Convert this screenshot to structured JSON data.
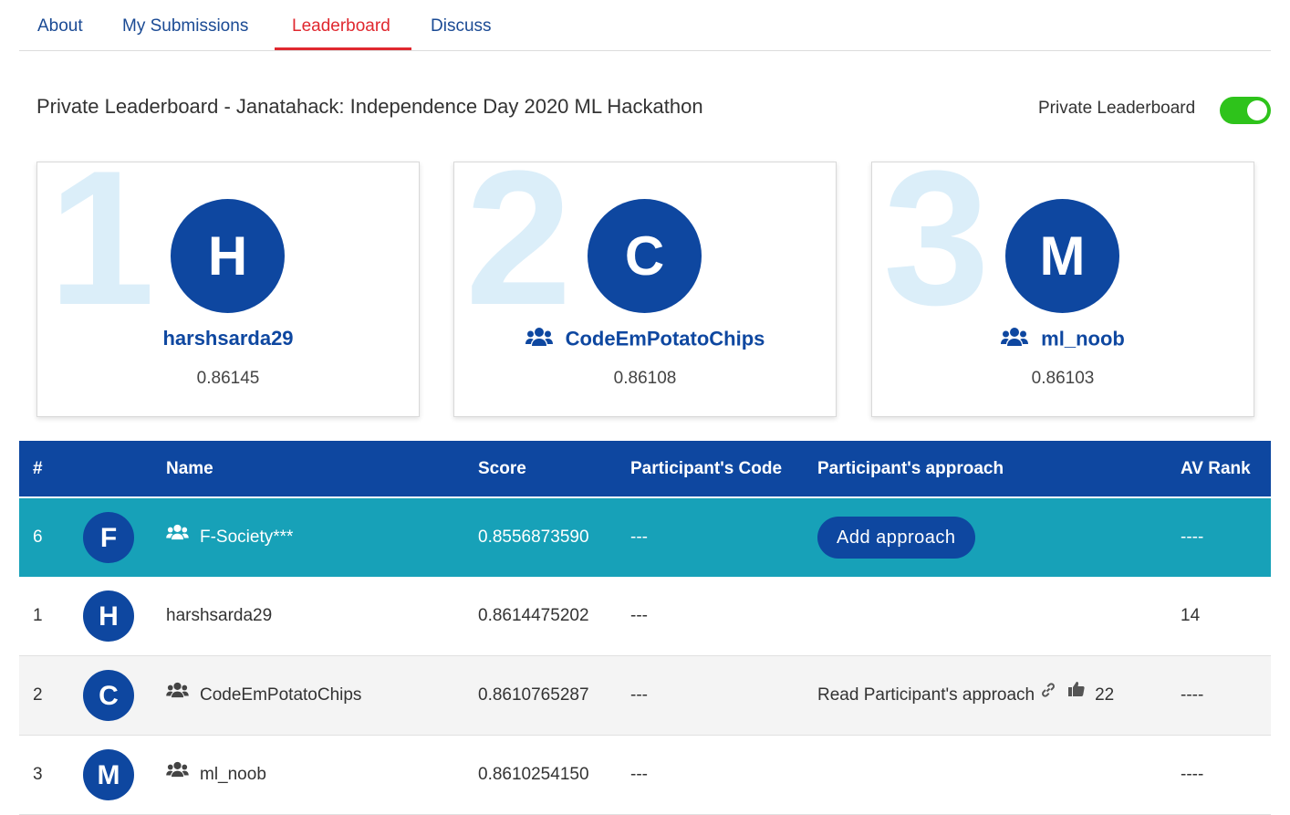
{
  "tabs": [
    {
      "label": "About"
    },
    {
      "label": "My Submissions"
    },
    {
      "label": "Leaderboard"
    },
    {
      "label": "Discuss"
    }
  ],
  "title": "Private Leaderboard - Janatahack: Independence Day 2020 ML Hackathon",
  "toggle": {
    "label": "Private Leaderboard",
    "on": true
  },
  "podium": [
    {
      "rank": "1",
      "initial": "H",
      "name": "harshsarda29",
      "score": "0.86145",
      "team": false
    },
    {
      "rank": "2",
      "initial": "C",
      "name": "CodeEmPotatoChips",
      "score": "0.86108",
      "team": true
    },
    {
      "rank": "3",
      "initial": "M",
      "name": "ml_noob",
      "score": "0.86103",
      "team": true
    }
  ],
  "table": {
    "headers": {
      "rank": "#",
      "name": "Name",
      "score": "Score",
      "code": "Participant's Code",
      "approach": "Participant's approach",
      "av_rank": "AV Rank"
    },
    "rows": [
      {
        "rank": "6",
        "initial": "F",
        "name": "F-Society***",
        "score": "0.8556873590",
        "code": "---",
        "approach_button": "Add approach",
        "av_rank": "----"
      },
      {
        "rank": "1",
        "initial": "H",
        "name": "harshsarda29",
        "score": "0.8614475202",
        "code": "---",
        "av_rank": "14"
      },
      {
        "rank": "2",
        "initial": "C",
        "name": "CodeEmPotatoChips",
        "score": "0.8610765287",
        "code": "---",
        "approach_text": "Read Participant's approach",
        "likes": "22",
        "av_rank": "----"
      },
      {
        "rank": "3",
        "initial": "M",
        "name": "ml_noob",
        "score": "0.8610254150",
        "code": "---",
        "av_rank": "----"
      }
    ]
  },
  "colors": {
    "brand": "#0e47a0",
    "active_tab": "#e0282f",
    "highlight_row": "#17a1b8",
    "toggle_on": "#2ec31b",
    "rank_watermark": "#dbeef9"
  }
}
